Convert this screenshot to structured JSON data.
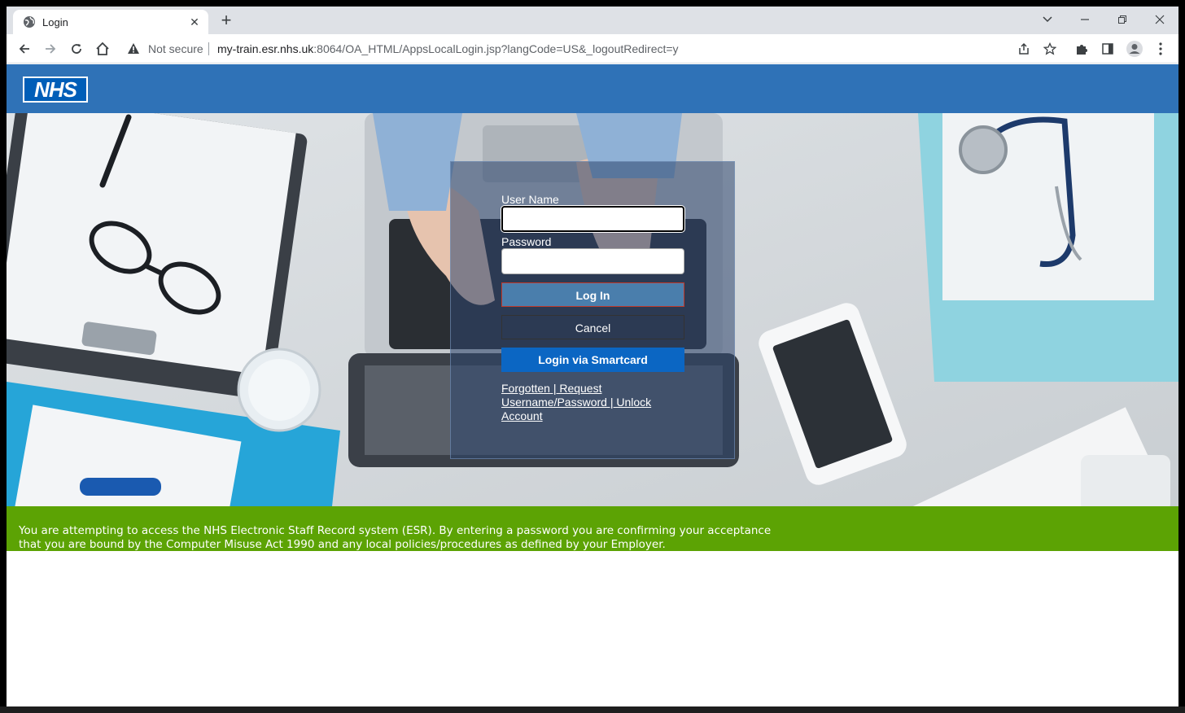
{
  "browser": {
    "tab_title": "Login",
    "tab_close": "✕",
    "new_tab": "+",
    "security_label": "Not secure",
    "url_host": "my-train.esr.nhs.uk",
    "url_path": ":8064/OA_HTML/AppsLocalLogin.jsp?langCode=US&_logoutRedirect=y"
  },
  "header": {
    "logo_text": "NHS"
  },
  "login": {
    "username_label": "User Name",
    "password_label": "Password",
    "login_button": "Log In",
    "cancel_button": "Cancel",
    "smartcard_button": "Login via Smartcard",
    "link_forgotten": "Forgotten | Request Username/Password | Unlock Account"
  },
  "notice": {
    "text": "You are attempting to access the NHS Electronic Staff Record system (ESR). By entering a password you are confirming your acceptance that you are bound by the Computer Misuse Act 1990 and any local policies/procedures as defined by your Employer."
  },
  "colors": {
    "header_blue": "#2f72b7",
    "notice_green": "#5ca304",
    "smartcard_blue": "#0b66c3",
    "login_button": "#4a7eac"
  },
  "icons": {
    "favicon": "globe-icon",
    "back": "arrow-left-icon",
    "forward": "arrow-right-icon",
    "reload": "reload-icon",
    "home": "home-icon",
    "warning": "warning-triangle-icon",
    "share": "share-icon",
    "bookmark": "star-icon",
    "extensions": "puzzle-icon",
    "side_panel": "side-panel-icon",
    "profile": "profile-icon",
    "menu": "kebab-menu-icon"
  }
}
